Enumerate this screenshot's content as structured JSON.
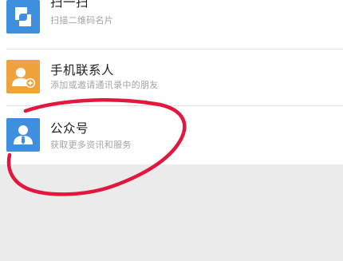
{
  "list": {
    "items": [
      {
        "title": "扫一扫",
        "subtitle": "扫描二维码名片",
        "icon": "scan-icon",
        "icon_color": "#3f8fdf"
      },
      {
        "title": "手机联系人",
        "subtitle": "添加或邀请通讯录中的朋友",
        "icon": "add-contact-icon",
        "icon_color": "#f0a23c"
      },
      {
        "title": "公众号",
        "subtitle": "获取更多资讯和服务",
        "icon": "official-account-icon",
        "icon_color": "#3f8fdf"
      }
    ]
  },
  "annotation": {
    "color": "#e3163e",
    "shape": "hand-drawn-circle"
  }
}
